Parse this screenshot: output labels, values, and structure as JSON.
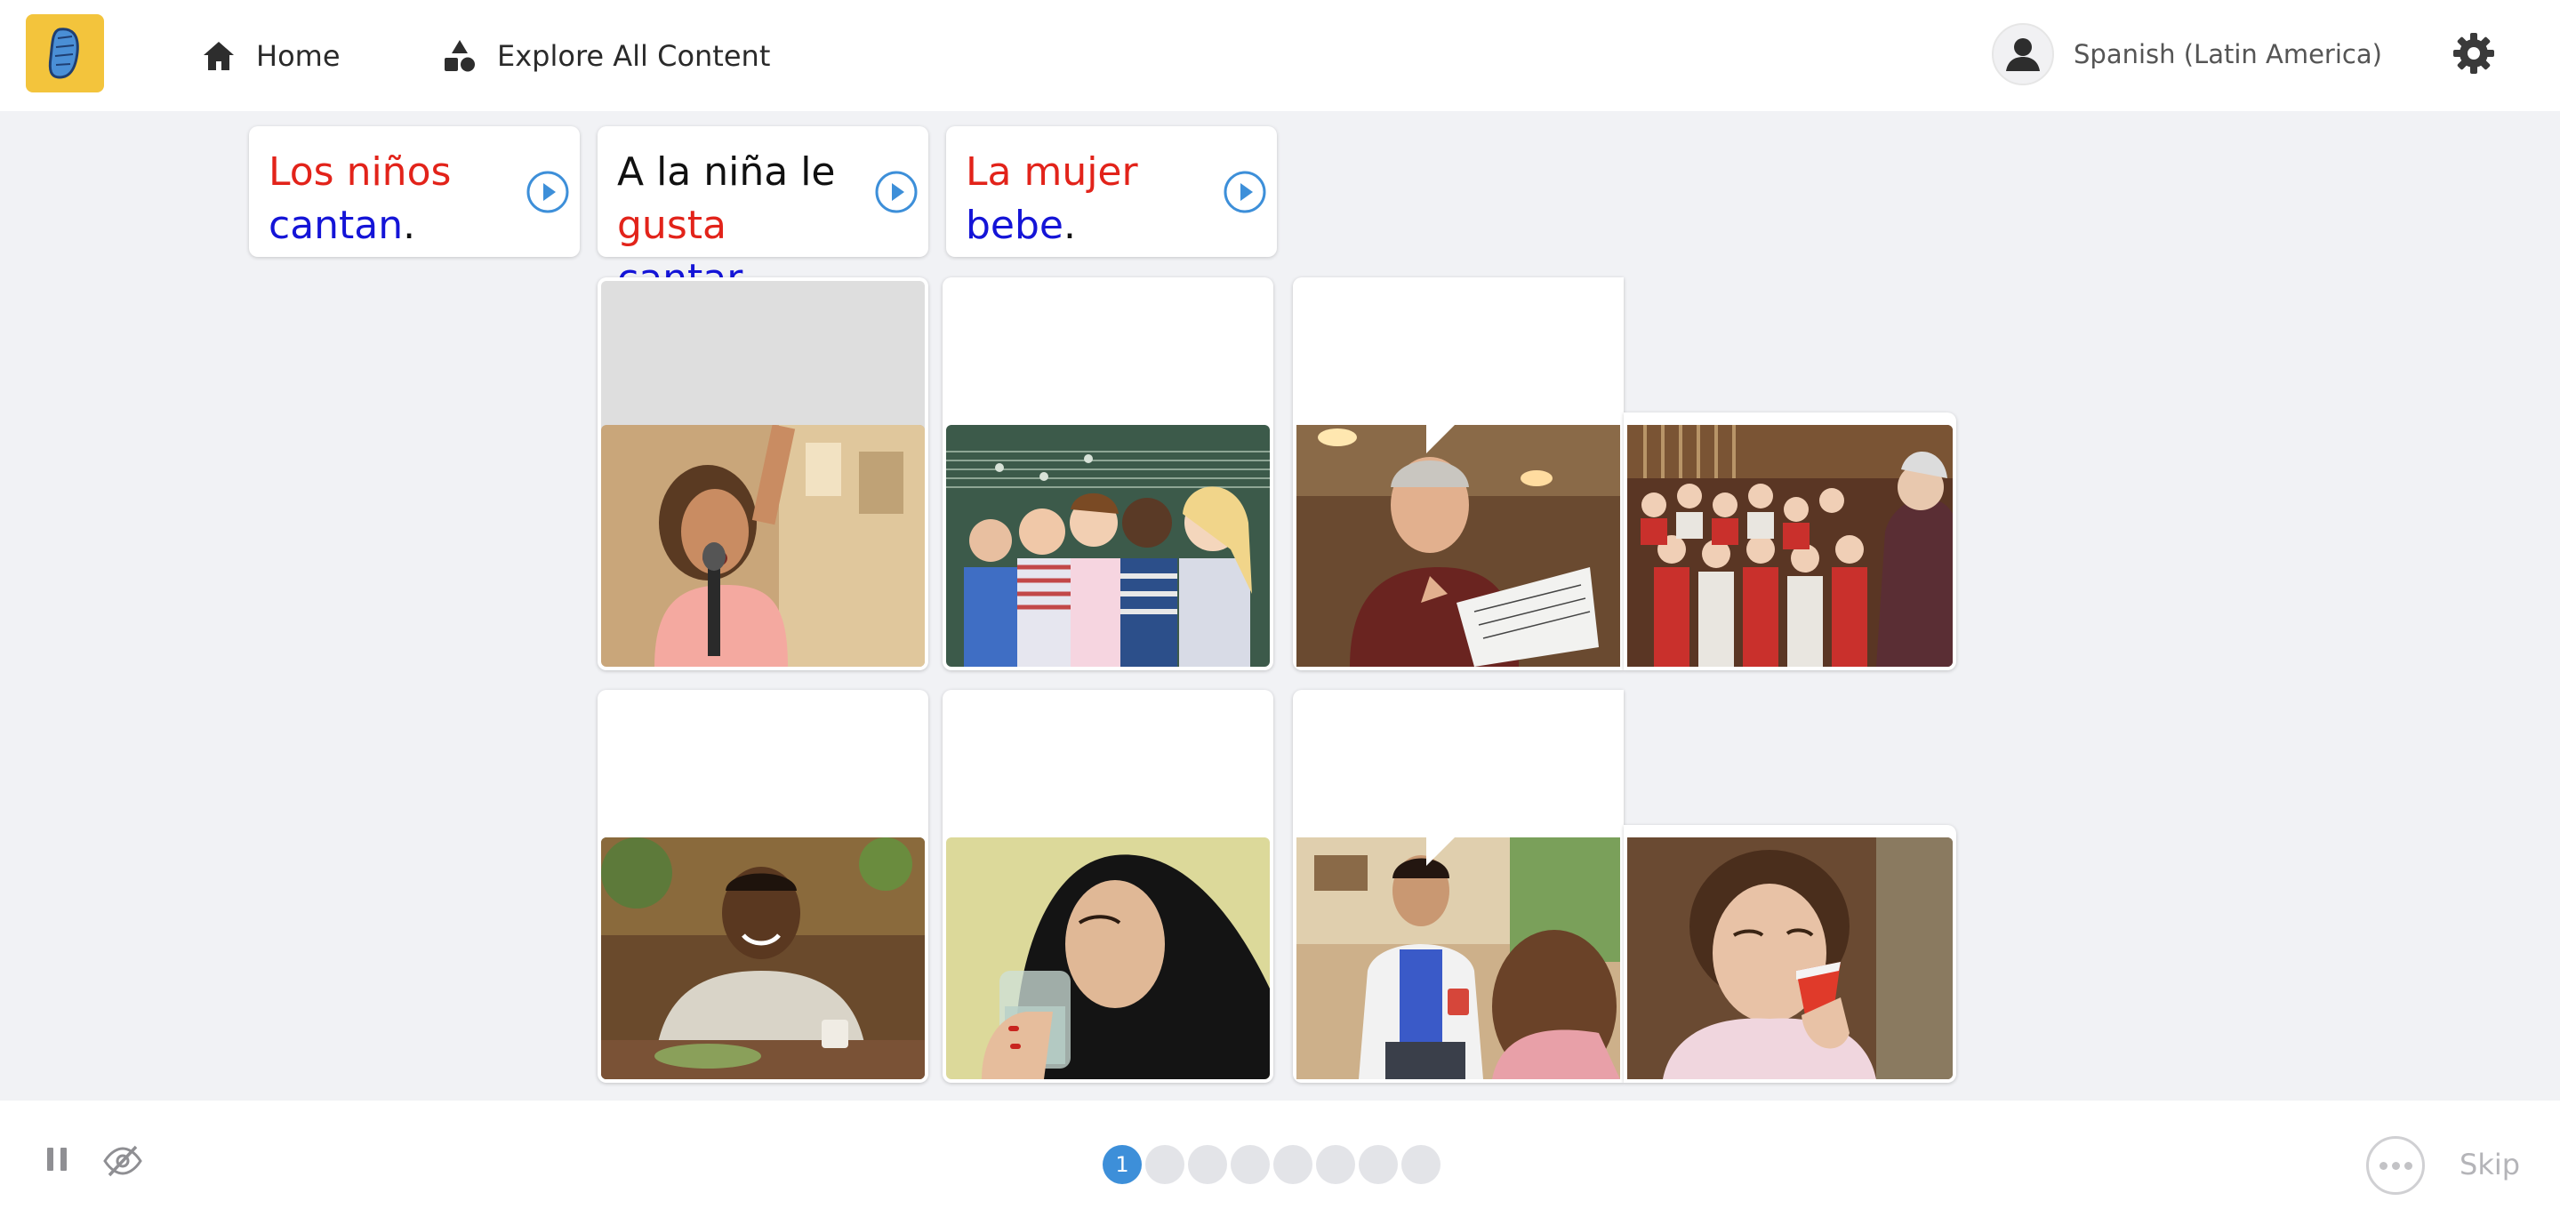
{
  "nav": {
    "home_label": "Home",
    "explore_label": "Explore All Content",
    "language_label": "Spanish (Latin America)"
  },
  "phrases": [
    {
      "parts": [
        {
          "text": "Los niños",
          "color": "red"
        },
        {
          "text": "cantan",
          "color": "blue"
        },
        {
          "text": ".",
          "color": "dark"
        }
      ]
    },
    {
      "parts": [
        {
          "text": "A la niña le",
          "color": "dark"
        },
        {
          "text": "gusta",
          "color": "red"
        },
        {
          "text": "cantar",
          "color": "blue"
        },
        {
          "text": ".",
          "color": "dark"
        }
      ]
    },
    {
      "parts": [
        {
          "text": "La mujer",
          "color": "red"
        },
        {
          "text": "bebe",
          "color": "blue"
        },
        {
          "text": ".",
          "color": "dark"
        }
      ]
    }
  ],
  "images": [
    {
      "subject": "girl singing into a hairbrush"
    },
    {
      "subject": "children singing in front of a chalkboard"
    },
    {
      "subject": "man singing with sheet music"
    },
    {
      "subject": "choir singing with conductor"
    },
    {
      "subject": "young man smiling at a table"
    },
    {
      "subject": "woman in headscarf drinking water"
    },
    {
      "subject": "doctor talking with a patient"
    },
    {
      "subject": "nurse drinking from a red cup"
    }
  ],
  "progress": {
    "current": "1",
    "total_steps": 8
  },
  "footer": {
    "skip_label": "Skip"
  },
  "colors": {
    "accent_blue": "#3d8fd9",
    "logo_yellow": "#f3c43c",
    "word_red": "#e2231a",
    "word_blue": "#1414d7"
  },
  "icons": [
    "rosetta-stone-logo-icon",
    "home-icon",
    "shapes-icon",
    "user-avatar-icon",
    "gear-icon",
    "play-audio-icon",
    "pause-icon",
    "hide-eye-icon",
    "more-options-icon"
  ]
}
